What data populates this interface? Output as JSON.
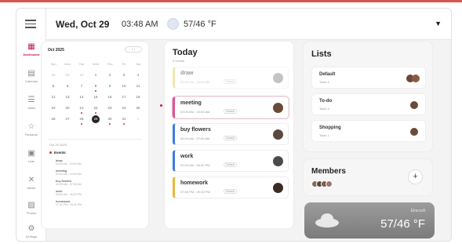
{
  "header": {
    "date": "Wed, Oct 29",
    "time": "03:48 AM",
    "temperature": "57/46 °F"
  },
  "sidebar": {
    "items": [
      {
        "label": "Dashboard",
        "icon": "dashboard-icon",
        "active": true
      },
      {
        "label": "Calendar",
        "icon": "calendar-icon"
      },
      {
        "label": "Tasks",
        "icon": "tasks-icon"
      },
      {
        "label": "Rewards",
        "icon": "rewards-icon"
      },
      {
        "label": "Lists",
        "icon": "lists-icon"
      },
      {
        "label": "Meals",
        "icon": "meals-icon"
      },
      {
        "label": "Photos",
        "icon": "photos-icon"
      },
      {
        "label": "Settings",
        "icon": "settings-icon"
      }
    ]
  },
  "calendar": {
    "month": "Oct 2025",
    "weekdays": [
      "Sun",
      "Mon",
      "Tue",
      "Wed",
      "Thu",
      "Fri",
      "Sat"
    ],
    "weeks": [
      [
        "28",
        "29",
        "30",
        "1",
        "2",
        "3",
        "4"
      ],
      [
        "5",
        "6",
        "7",
        "8",
        "9",
        "10",
        "11"
      ],
      [
        "12",
        "13",
        "14",
        "15",
        "16",
        "17",
        "18"
      ],
      [
        "19",
        "20",
        "21",
        "22",
        "23",
        "24",
        "25"
      ],
      [
        "26",
        "27",
        "28",
        "29",
        "30",
        "31",
        "1"
      ]
    ],
    "selected_date": "Oct 29 2025",
    "events_label": "Events",
    "events": [
      {
        "name": "draw",
        "time": "02:00 AM - 03:00 AM"
      },
      {
        "name": "meeting",
        "time": "03:00 AM - 04:00 AM"
      },
      {
        "name": "buy flowers",
        "time": "06:00 AM - 07:00 AM"
      },
      {
        "name": "work",
        "time": "09:00 AM - 06:00 PM"
      },
      {
        "name": "homework",
        "time": "07:00 PM - 09:00 PM"
      }
    ]
  },
  "today": {
    "title": "Today",
    "subtitle": "5 events",
    "events": [
      {
        "name": "draw",
        "time": "02:00 AM - 03:00 AM",
        "tag": "Default",
        "color": "#e6d36b"
      },
      {
        "name": "meeting",
        "time": "03:00 AM - 04:00 AM",
        "tag": "Default",
        "color": "#e05297"
      },
      {
        "name": "buy flowers",
        "time": "06:00 AM - 07:00 AM",
        "tag": "Default",
        "color": "#3f7be0"
      },
      {
        "name": "work",
        "time": "09:00 AM - 06:00 PM",
        "tag": "Default",
        "color": "#3f7be0"
      },
      {
        "name": "homework",
        "time": "07:00 PM - 09:00 PM",
        "tag": "Default",
        "color": "#e6b83b"
      }
    ]
  },
  "lists": {
    "title": "Lists",
    "items": [
      {
        "name": "Default",
        "count": "Total: 0"
      },
      {
        "name": "To-do",
        "count": "Total: 0"
      },
      {
        "name": "Shopping",
        "count": "Total: 1"
      }
    ]
  },
  "members": {
    "title": "Members",
    "add_label": "+"
  },
  "weather": {
    "location": "Elmcroft",
    "temperature": "57/46 °F"
  },
  "colors": {
    "accent": "#c2185b",
    "event_dot": "#d32f2f"
  }
}
